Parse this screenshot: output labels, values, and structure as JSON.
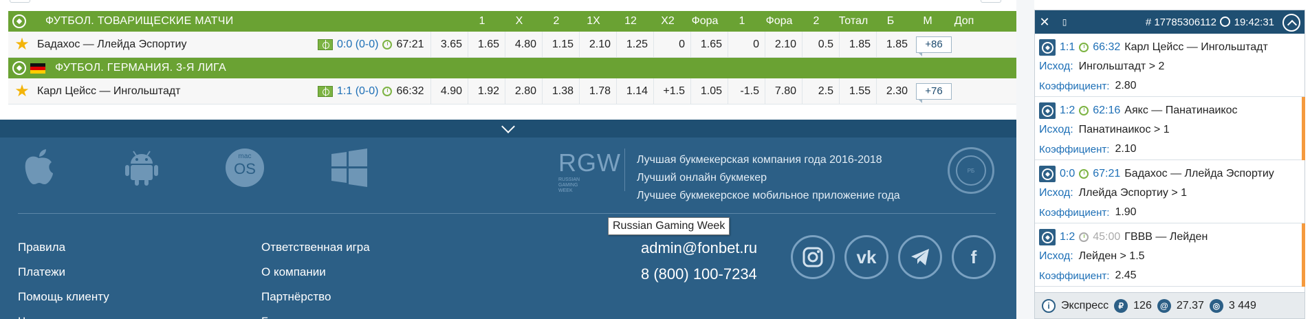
{
  "table": {
    "sections": [
      {
        "title": "ФУТБОЛ. ТОВАРИЩЕСКИЕ МАТЧИ",
        "columns": [
          "1",
          "X",
          "2",
          "1X",
          "12",
          "X2",
          "Фора",
          "1",
          "Фора",
          "2",
          "Тотал",
          "Б",
          "М",
          "Доп"
        ],
        "row": {
          "name": "Бадахос — Ллейда Эспортиу",
          "score": "0:0 (0-0)",
          "time": "67:21",
          "odds": [
            "3.65",
            "1.65",
            "4.80",
            "1.15",
            "2.10",
            "1.25",
            "0",
            "1.65",
            "0",
            "2.10",
            "0.5",
            "1.85",
            "1.85"
          ],
          "more": "+86"
        }
      },
      {
        "title": "ФУТБОЛ. ГЕРМАНИЯ. 3-Я ЛИГА",
        "row": {
          "name": "Карл Цейсс — Ингольштадт",
          "score": "1:1 (0-0)",
          "time": "66:32",
          "odds": [
            "4.90",
            "1.92",
            "2.80",
            "1.38",
            "1.78",
            "1.14",
            "+1.5",
            "1.05",
            "-1.5",
            "7.80",
            "2.5",
            "1.55",
            "2.30"
          ],
          "more": "+76"
        }
      }
    ]
  },
  "footer": {
    "rgw": {
      "big": "RGW",
      "small": [
        "RUSSIAN",
        "GAMING",
        "WEEK"
      ]
    },
    "awards": [
      "Лучшая букмекерская компания года 2016-2018",
      "Лучший онлайн букмекер",
      "Лучшее букмекерское мобильное приложение года"
    ],
    "os_label": {
      "top": "mac",
      "bottom": "OS"
    },
    "tooltip": "Russian Gaming Week",
    "links_col1": [
      "Правила",
      "Платежи",
      "Помощь клиенту",
      "Часто задаваемые вопросы"
    ],
    "links_col2": [
      "Ответственная игра",
      "О компании",
      "Партнёрство",
      "Благотворительность"
    ],
    "email": "admin@fonbet.ru",
    "phone": "8 (800) 100-7234",
    "seal_text": [
      "ЛЕГАЛЬНЫЕ БУКМЕКЕРЫ",
      "РЕКОМЕНДУЕТ",
      "РБ"
    ]
  },
  "slip": {
    "number": "# 17785306112",
    "time": "19:42:31",
    "outcome_label": "Исход:",
    "coef_label": "Коэффициент:",
    "bets": [
      {
        "score": "1:1",
        "time": "66:32",
        "match": "Карл Цейсс — Ингольштадт",
        "outcome": "Ингольштадт > 2",
        "coef": "2.80",
        "marked": false,
        "faded": false
      },
      {
        "score": "1:2",
        "time": "62:16",
        "match": "Аякс — Панатинаикос",
        "outcome": "Панатинаикос > 1",
        "coef": "2.10",
        "marked": true,
        "faded": false
      },
      {
        "score": "0:0",
        "time": "67:21",
        "match": "Бадахос — Ллейда Эспортиу",
        "outcome": "Ллейда Эспортиу > 1",
        "coef": "1.90",
        "marked": false,
        "faded": false
      },
      {
        "score": "1:2",
        "time": "45:00",
        "match": "ГВВВ — Лейден",
        "outcome": "Лейден > 1.5",
        "coef": "2.45",
        "marked": true,
        "faded": true
      }
    ],
    "footer": {
      "type": "Экспресс",
      "stake": "126",
      "coef": "27.37",
      "win": "3 449"
    }
  },
  "colors": {
    "section_green": "#6aa233",
    "footer_blue": "#2c5f86",
    "accent_orange": "#f59a3e",
    "link_blue": "#1d6fb6"
  }
}
